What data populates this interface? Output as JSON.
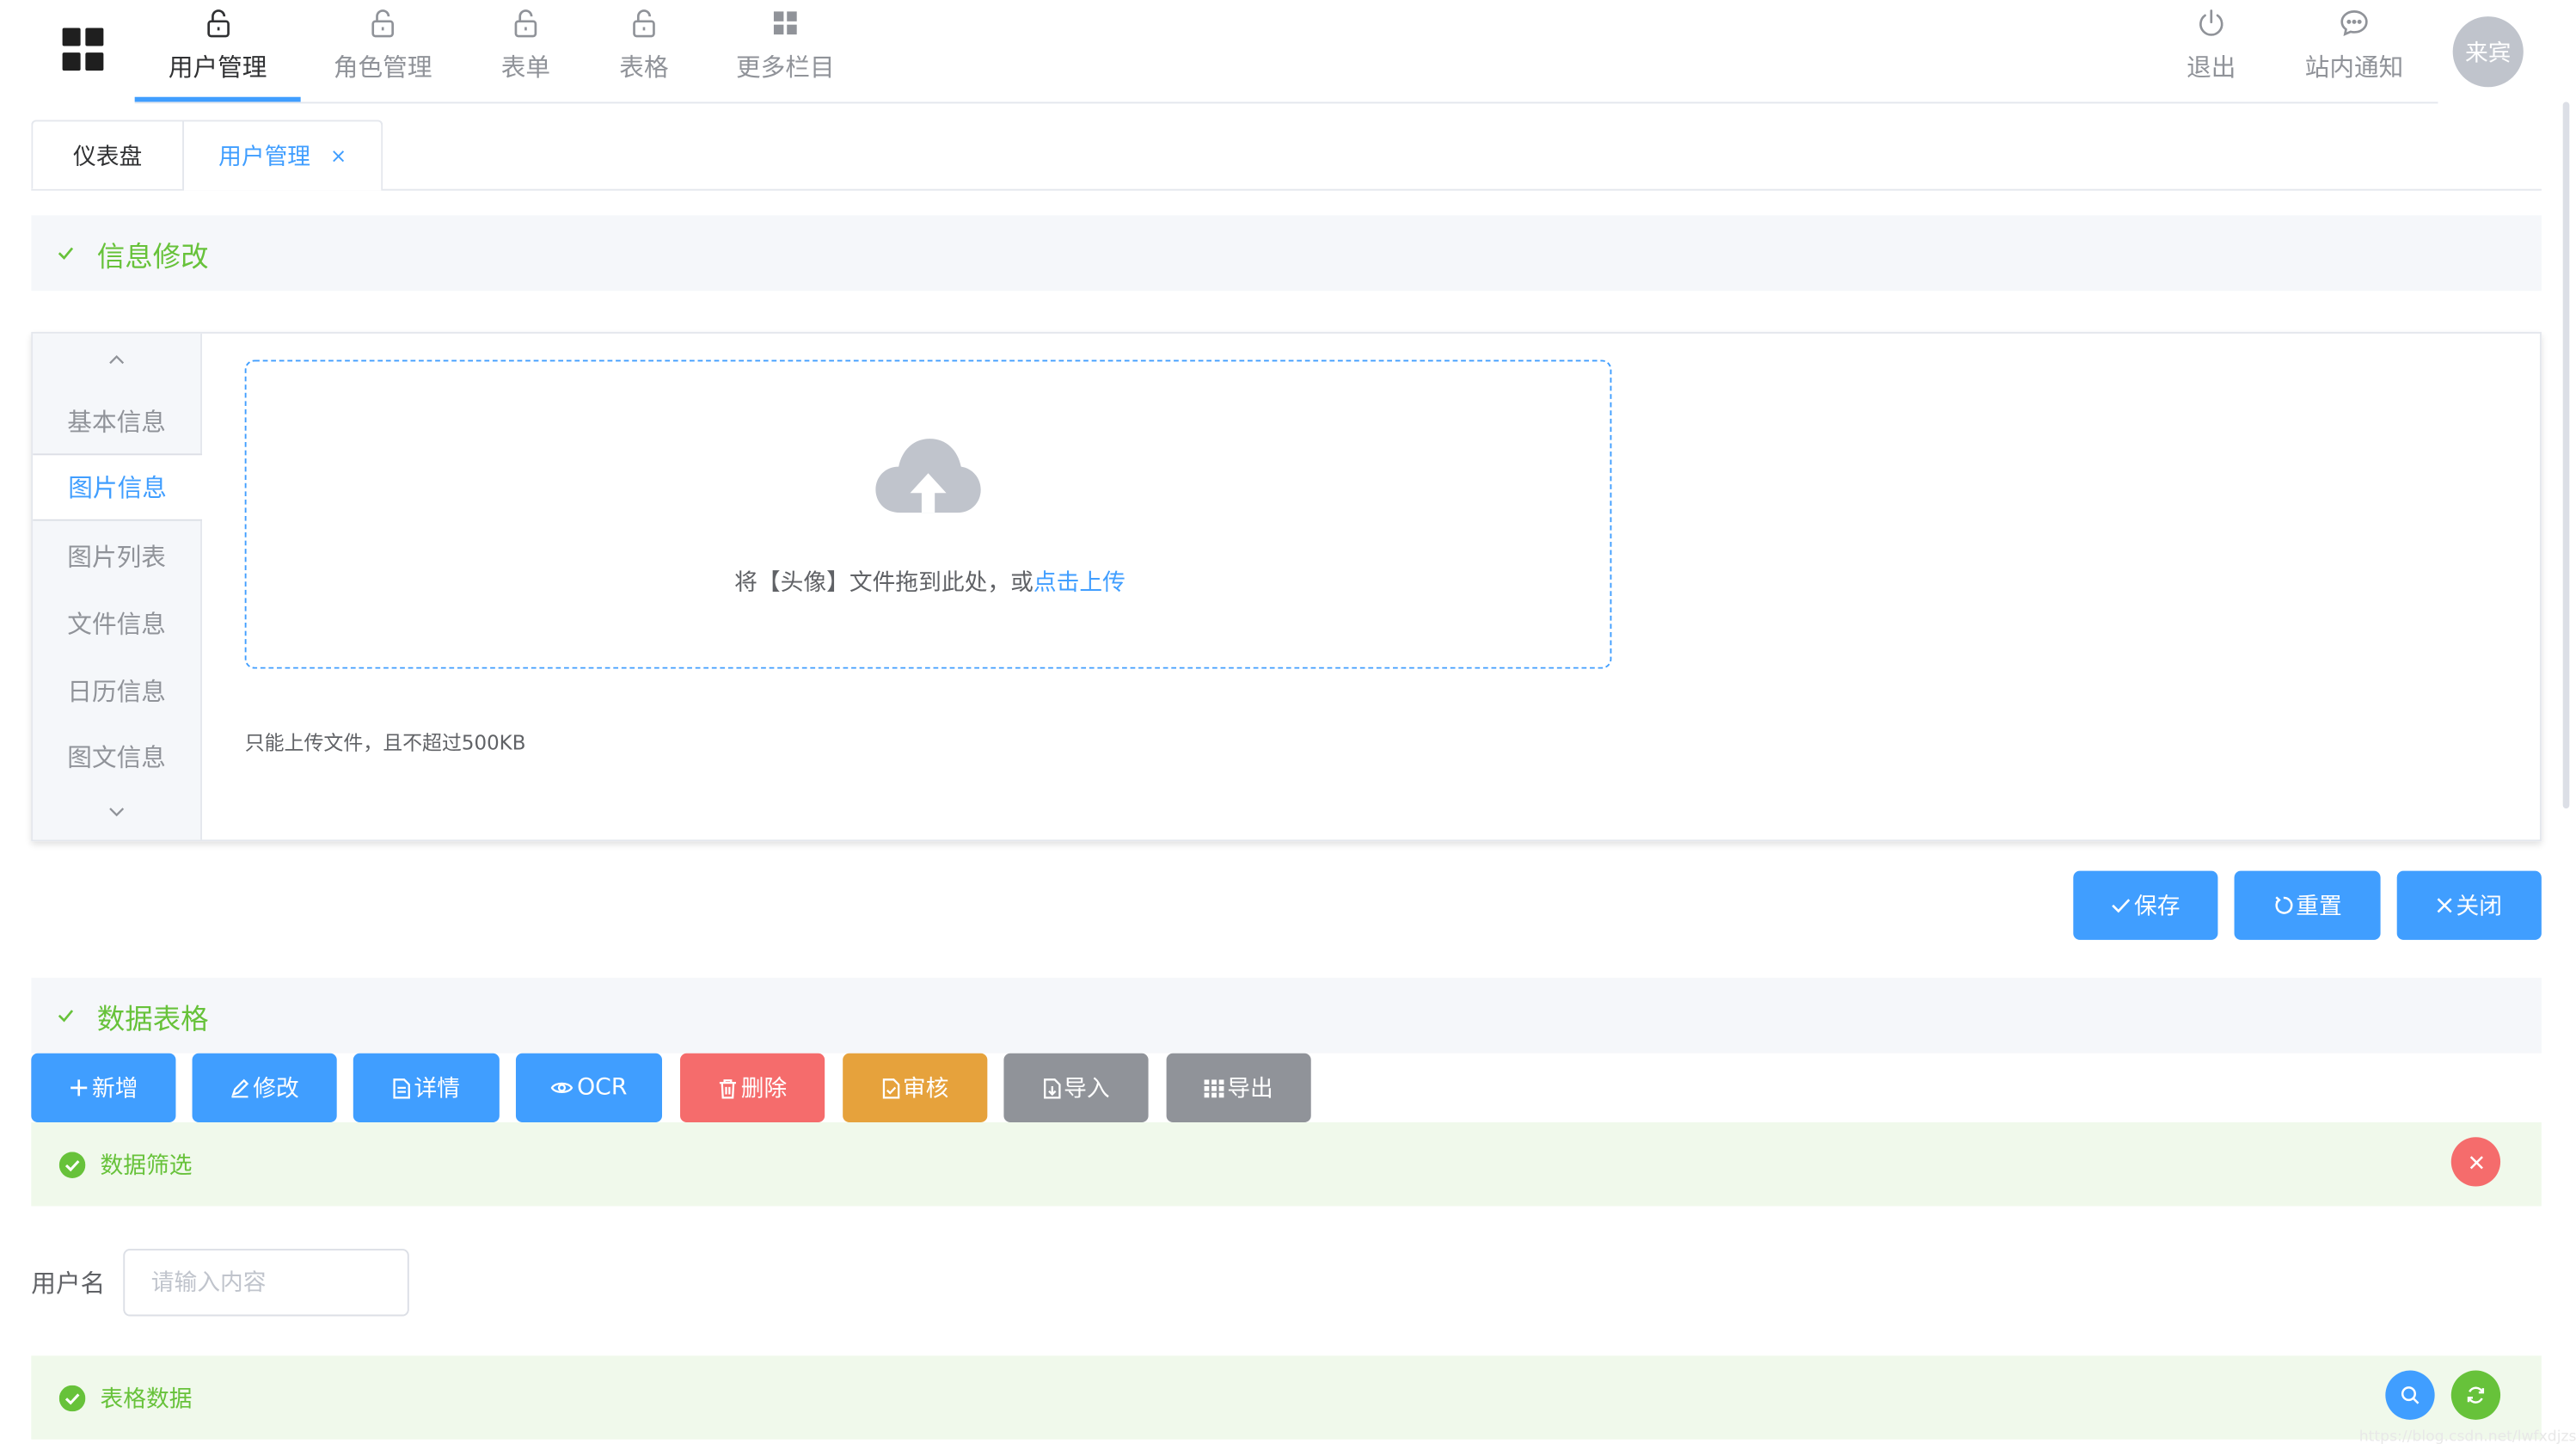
{
  "nav": {
    "items": [
      {
        "label": "用户管理",
        "icon": "lock-icon",
        "active": true
      },
      {
        "label": "角色管理",
        "icon": "lock-icon"
      },
      {
        "label": "表单",
        "icon": "lock-icon"
      },
      {
        "label": "表格",
        "icon": "lock-icon"
      },
      {
        "label": "更多栏目",
        "icon": "grid-icon"
      }
    ],
    "logout_label": "退出",
    "notice_label": "站内通知",
    "avatar_text": "来宾"
  },
  "tabs": [
    {
      "label": "仪表盘"
    },
    {
      "label": "用户管理",
      "active": true,
      "closable": true,
      "close_symbol": "×"
    }
  ],
  "info_section": {
    "title": "信息修改",
    "side_tabs": [
      "基本信息",
      "图片信息",
      "图片列表",
      "文件信息",
      "日历信息",
      "图文信息"
    ],
    "active_side_tab": "图片信息",
    "upload": {
      "text": "将【头像】文件拖到此处，或",
      "link": "点击上传",
      "tip": "只能上传文件，且不超过500KB"
    },
    "actions": {
      "save": "保存",
      "reset": "重置",
      "close": "关闭"
    }
  },
  "data_section": {
    "title": "数据表格",
    "toolbar": {
      "add": "新增",
      "edit": "修改",
      "detail": "详情",
      "ocr": "OCR",
      "delete": "删除",
      "audit": "审核",
      "import": "导入",
      "export": "导出"
    },
    "filter": {
      "title": "数据筛选",
      "username_label": "用户名",
      "username_placeholder": "请输入内容",
      "username_value": ""
    },
    "table": {
      "title": "表格数据"
    }
  },
  "watermark": "https://blog.csdn.net/lwfxdjzsjhngq",
  "colors": {
    "primary": "#409eff",
    "success": "#67c23a",
    "danger": "#f56c6c",
    "warning": "#e6a23c",
    "info": "#909399"
  }
}
